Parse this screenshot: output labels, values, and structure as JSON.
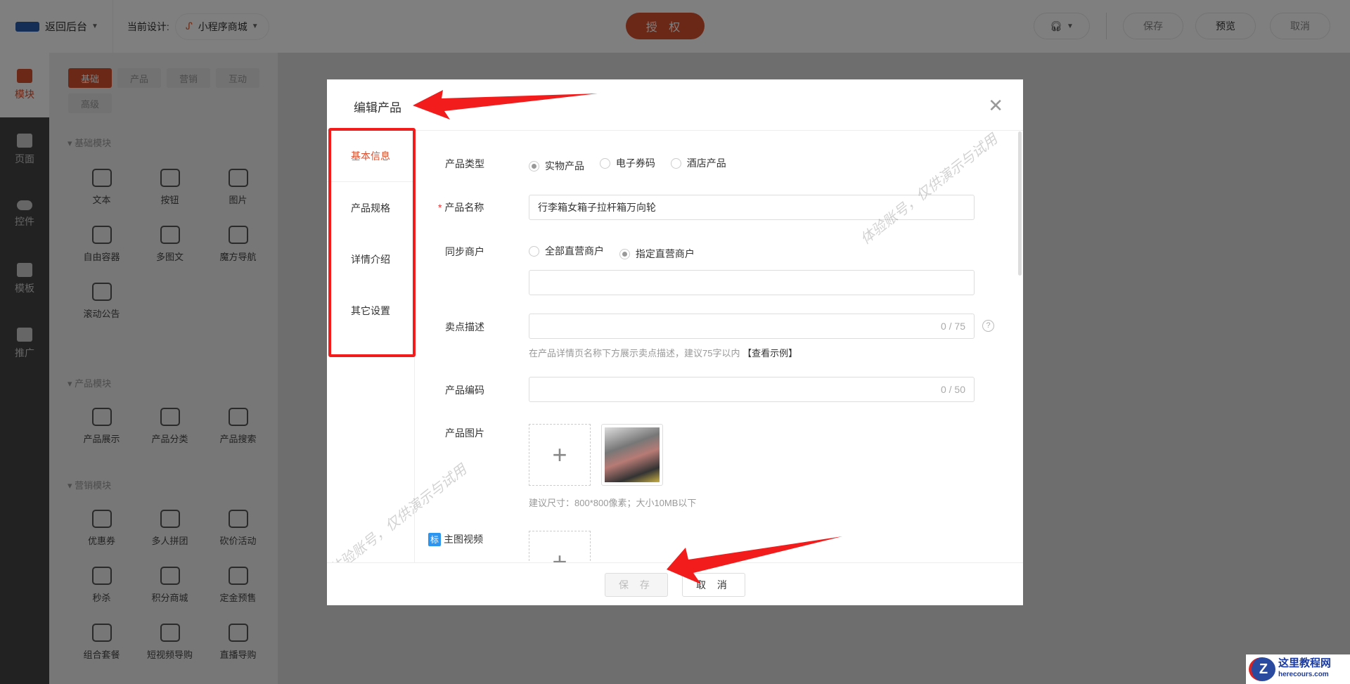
{
  "topbar": {
    "back": "返回后台",
    "current_label": "当前设计:",
    "design": "小程序商城",
    "auth": "授 权",
    "save": "保存",
    "preview": "预览",
    "cancel": "取消"
  },
  "leftnav": [
    {
      "label": "模块"
    },
    {
      "label": "页面"
    },
    {
      "label": "控件"
    },
    {
      "label": "模板"
    },
    {
      "label": "推广"
    }
  ],
  "panel": {
    "tabs": [
      "基础",
      "产品",
      "营销",
      "互动",
      "高级"
    ],
    "sections": [
      {
        "title": "基础模块",
        "items": [
          "文本",
          "按钮",
          "图片",
          "自由容器",
          "多图文",
          "魔方导航",
          "滚动公告"
        ]
      },
      {
        "title": "产品模块",
        "items": [
          "产品展示",
          "产品分类",
          "产品搜索"
        ]
      },
      {
        "title": "营销模块",
        "items": [
          "优惠券",
          "多人拼团",
          "砍价活动",
          "秒杀",
          "积分商城",
          "定金预售",
          "组合套餐",
          "短视频导购",
          "直播导购"
        ]
      }
    ]
  },
  "modal": {
    "title": "编辑产品",
    "nav": [
      "基本信息",
      "产品规格",
      "详情介绍",
      "其它设置"
    ],
    "type_label": "产品类型",
    "type_options": [
      "实物产品",
      "电子券码",
      "酒店产品"
    ],
    "name_label": "产品名称",
    "name_value": "行李箱女箱子拉杆箱万向轮",
    "sync_label": "同步商户",
    "sync_options": [
      "全部直营商户",
      "指定直营商户"
    ],
    "selling_label": "卖点描述",
    "selling_count": "0 / 75",
    "selling_hint": "在产品详情页名称下方展示卖点描述，建议75字以内",
    "selling_link": "【查看示例】",
    "code_label": "产品编码",
    "code_count": "0 / 50",
    "image_label": "产品图片",
    "image_hint": "建议尺寸：800*800像素；大小10MB以下",
    "video_badge": "标",
    "video_label": "主图视频",
    "save": "保 存",
    "cancel": "取 消",
    "watermark": "体验账号，仅供演示与试用"
  },
  "brand": {
    "name": "这里教程网",
    "url": "herecours.com"
  }
}
